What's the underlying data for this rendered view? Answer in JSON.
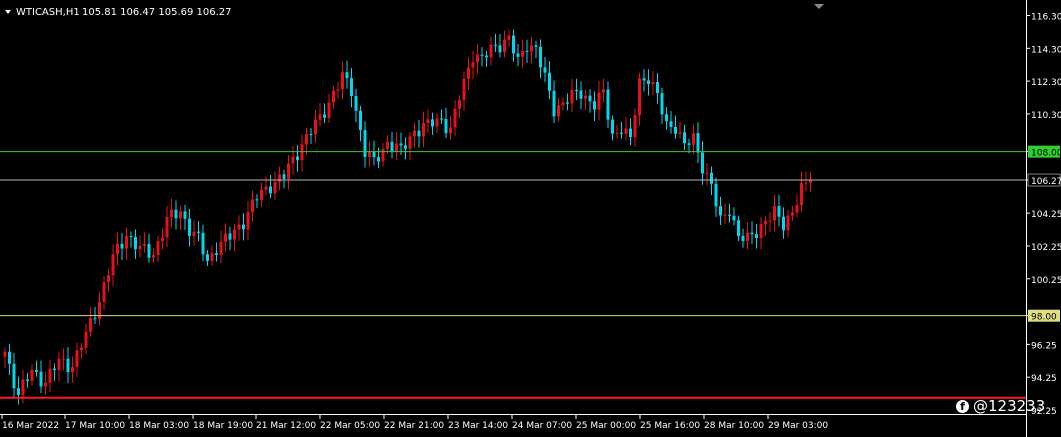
{
  "header": {
    "symbol": "WTICASH,H1",
    "ohlc": "105.81 106.47 105.69 106.27",
    "menu_icon": "triangle-down-icon"
  },
  "watermark": {
    "icon": "facebook-icon",
    "text": "@123233"
  },
  "colors": {
    "background": "#000000",
    "bull": "#00d8f0",
    "bear": "#e8101a",
    "axis_text": "#ffffff",
    "level_green": "#2fd02f",
    "level_yellow": "#e0e080",
    "level_red": "#ff1818",
    "current_line": "#b8b8b8"
  },
  "chart_data": {
    "type": "candlestick",
    "title": "WTICASH,H1",
    "ylim": [
      92.25,
      117.0
    ],
    "y_ticks": [
      "116.30",
      "114.30",
      "112.30",
      "110.30",
      "108.00",
      "106.27",
      "104.25",
      "102.25",
      "100.25",
      "98.00",
      "96.25",
      "94.25",
      "92.25"
    ],
    "x_ticks": [
      "16 Mar 2022",
      "17 Mar 10:00",
      "18 Mar 03:00",
      "18 Mar 19:00",
      "21 Mar 12:00",
      "22 Mar 05:00",
      "22 Mar 21:00",
      "23 Mar 14:00",
      "24 Mar 07:00",
      "25 Mar 00:00",
      "25 Mar 16:00",
      "28 Mar 10:00",
      "29 Mar 03:00"
    ],
    "levels": [
      {
        "label": "108.00",
        "value": 108.0,
        "color": "green"
      },
      {
        "label": "106.27",
        "value": 106.27,
        "color": "current"
      },
      {
        "label": "98.00",
        "value": 98.0,
        "color": "yellow"
      },
      {
        "label": "93.00",
        "value": 93.0,
        "color": "red"
      }
    ],
    "current_price": 106.27,
    "close_path": [
      [
        0,
        95.8
      ],
      [
        3,
        93.2
      ],
      [
        6,
        94.6
      ],
      [
        9,
        94.0
      ],
      [
        12,
        95.2
      ],
      [
        15,
        95.0
      ],
      [
        18,
        96.8
      ],
      [
        21,
        99.0
      ],
      [
        24,
        101.5
      ],
      [
        27,
        103.0
      ],
      [
        30,
        102.0
      ],
      [
        33,
        101.8
      ],
      [
        36,
        103.8
      ],
      [
        39,
        104.4
      ],
      [
        41,
        103.3
      ],
      [
        43,
        102.6
      ],
      [
        45,
        101.3
      ],
      [
        47,
        102.2
      ],
      [
        50,
        102.8
      ],
      [
        53,
        103.8
      ],
      [
        56,
        105.2
      ],
      [
        59,
        106.0
      ],
      [
        62,
        106.5
      ],
      [
        66,
        108.5
      ],
      [
        70,
        110.0
      ],
      [
        73,
        111.6
      ],
      [
        75,
        112.5
      ],
      [
        77,
        111.8
      ],
      [
        80,
        108.0
      ],
      [
        82,
        107.3
      ],
      [
        85,
        108.6
      ],
      [
        88,
        108.0
      ],
      [
        91,
        109.3
      ],
      [
        94,
        109.6
      ],
      [
        97,
        110.0
      ],
      [
        99,
        109.3
      ],
      [
        101,
        111.3
      ],
      [
        104,
        114.0
      ],
      [
        106,
        113.6
      ],
      [
        108,
        114.2
      ],
      [
        110,
        114.6
      ],
      [
        112,
        114.9
      ],
      [
        114,
        113.4
      ],
      [
        116,
        114.6
      ],
      [
        118,
        114.3
      ],
      [
        120,
        112.4
      ],
      [
        122,
        110.6
      ],
      [
        125,
        111.2
      ],
      [
        128,
        111.6
      ],
      [
        131,
        110.9
      ],
      [
        133,
        111.5
      ],
      [
        135,
        109.0
      ],
      [
        137,
        109.5
      ],
      [
        139,
        108.6
      ],
      [
        141,
        112.3
      ],
      [
        143,
        112.6
      ],
      [
        145,
        111.3
      ],
      [
        147,
        109.6
      ],
      [
        149,
        109.6
      ],
      [
        151,
        108.3
      ],
      [
        153,
        108.8
      ],
      [
        155,
        107.2
      ],
      [
        157,
        105.9
      ],
      [
        159,
        103.7
      ],
      [
        161,
        104.6
      ],
      [
        163,
        102.8
      ],
      [
        165,
        102.6
      ],
      [
        167,
        103.2
      ],
      [
        169,
        103.8
      ],
      [
        171,
        104.2
      ],
      [
        173,
        103.6
      ],
      [
        175,
        104.4
      ],
      [
        177,
        105.6
      ],
      [
        179,
        106.27
      ]
    ],
    "grid": false,
    "legend": "none"
  }
}
